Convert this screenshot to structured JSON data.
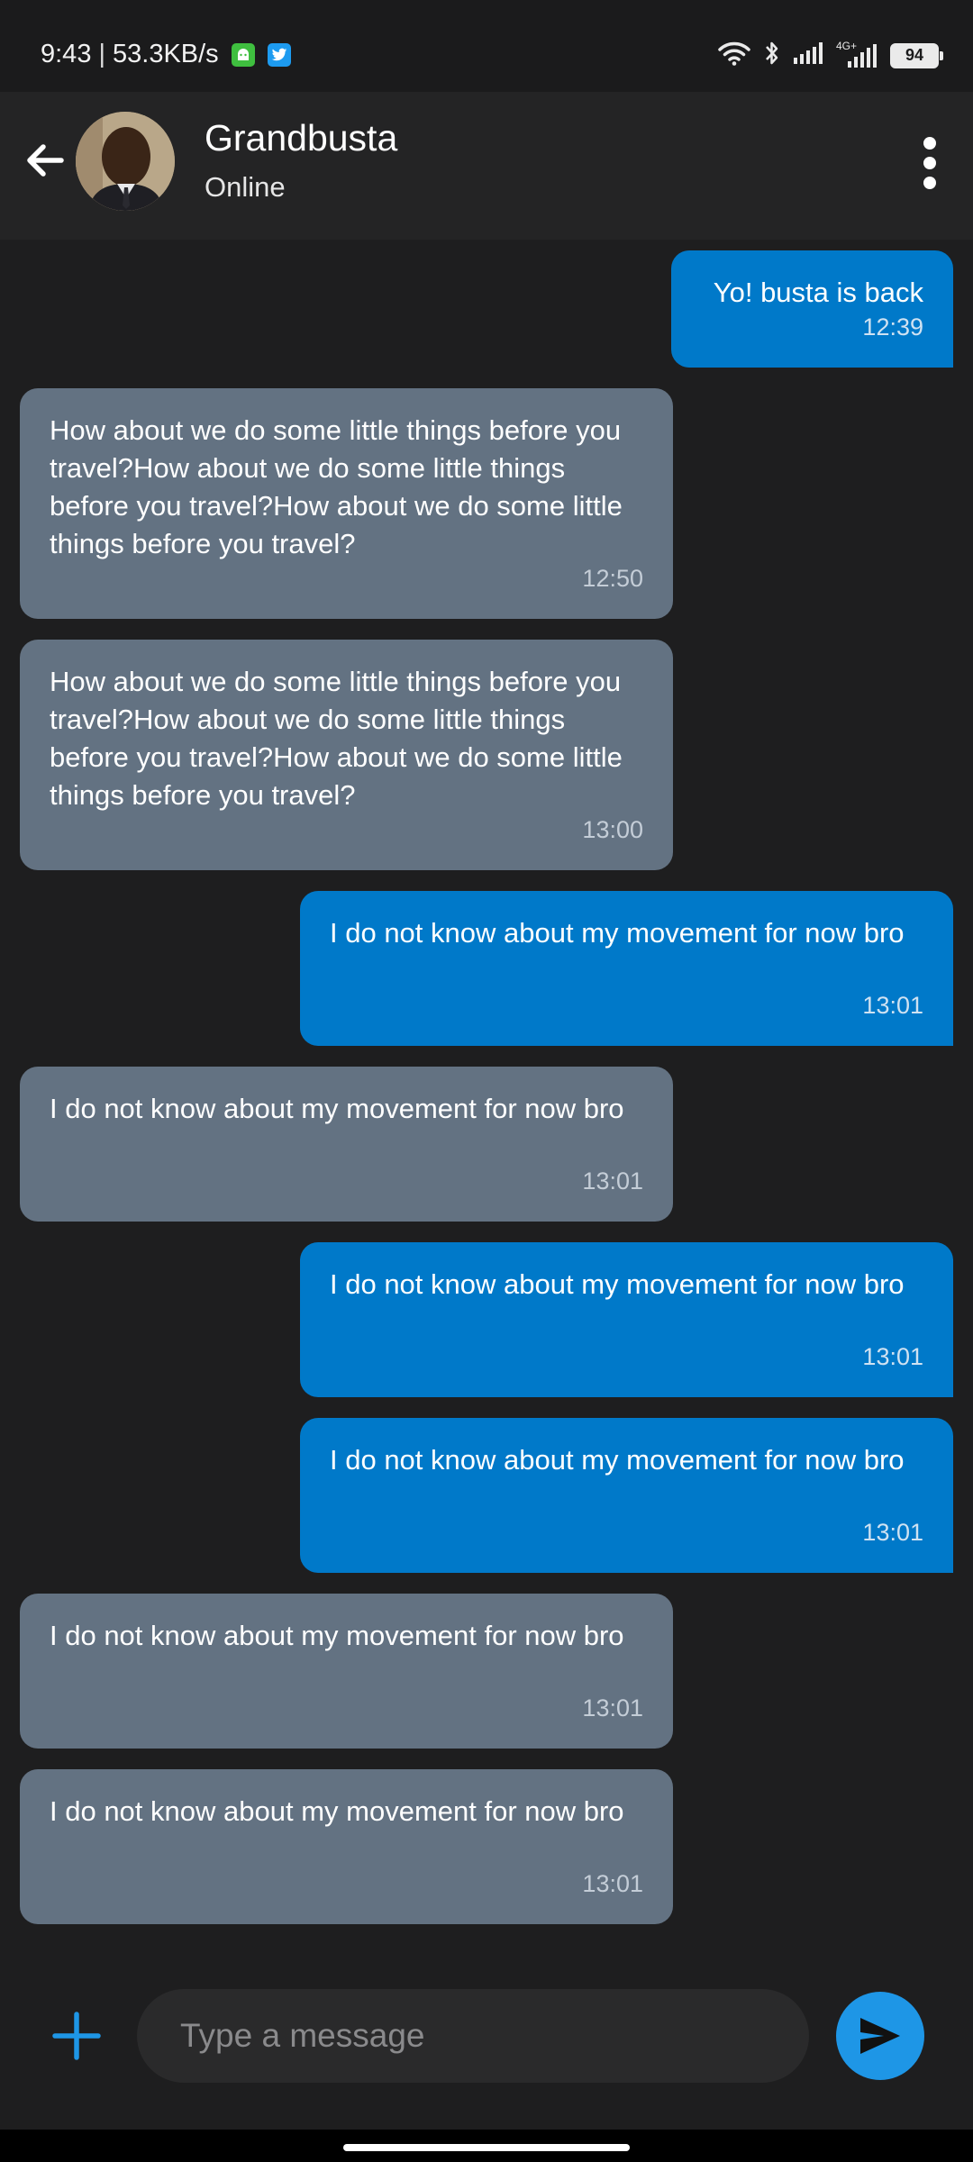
{
  "status_bar": {
    "time": "9:43",
    "separator": "|",
    "network_speed": "53.3KB/s",
    "notification_icons": [
      "android-icon",
      "twitter-icon"
    ],
    "network_type": "4G+",
    "battery_level": "94"
  },
  "header": {
    "contact_name": "Grandbusta",
    "contact_status": "Online"
  },
  "messages": [
    {
      "direction": "out",
      "text": "Yo! busta is back",
      "time": "12:39"
    },
    {
      "direction": "in",
      "text": "How about we do some little things before you travel?How about we do some little things before you travel?How about we do some little things before you travel?",
      "time": "12:50"
    },
    {
      "direction": "in",
      "text": "How about we do some little things before you travel?How about we do some little things before you travel?How about we do some little things before you travel?",
      "time": "13:00"
    },
    {
      "direction": "out",
      "text": "I do not know about my movement for now bro",
      "time": "13:01"
    },
    {
      "direction": "in",
      "text": "I do not know about my movement for now bro",
      "time": "13:01"
    },
    {
      "direction": "out",
      "text": "I do not know about my movement for now bro",
      "time": "13:01"
    },
    {
      "direction": "out",
      "text": "I do not know about my movement for now bro",
      "time": "13:01"
    },
    {
      "direction": "in",
      "text": "I do not know about my movement for now bro",
      "time": "13:01"
    },
    {
      "direction": "in",
      "text": "I do not know about my movement for now bro",
      "time": "13:01"
    }
  ],
  "composer": {
    "placeholder": "Type a message",
    "value": ""
  },
  "colors": {
    "outgoing_bubble": "#0079c9",
    "incoming_bubble": "#637282",
    "send_button": "#1e96e6",
    "background": "#1e1e1f",
    "header": "#242425"
  }
}
